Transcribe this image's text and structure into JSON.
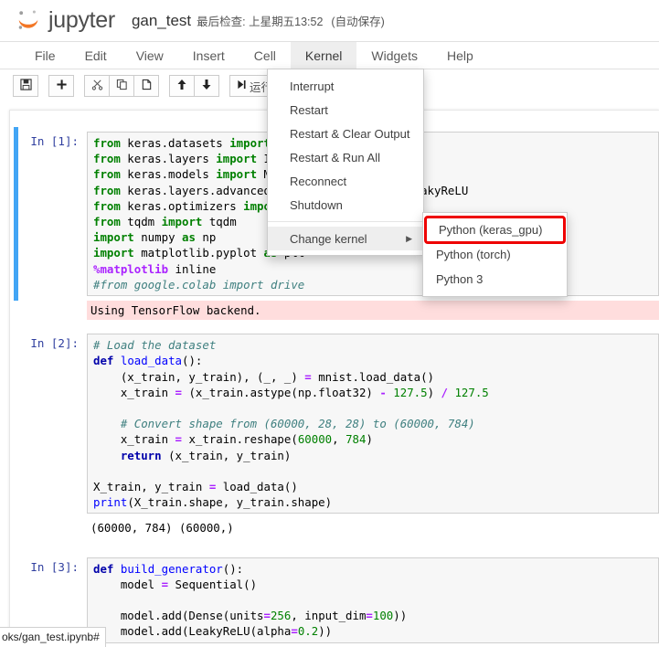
{
  "header": {
    "logo_icon": "jupyter-logo-icon",
    "brand": "jupyter",
    "notebook_name": "gan_test",
    "checkpoint": "最后检查: 上星期五13:52",
    "autosave": "(自动保存)",
    "accent_color": "#F37726"
  },
  "menubar": {
    "items": [
      {
        "label": "File",
        "active": false
      },
      {
        "label": "Edit",
        "active": false
      },
      {
        "label": "View",
        "active": false
      },
      {
        "label": "Insert",
        "active": false
      },
      {
        "label": "Cell",
        "active": false
      },
      {
        "label": "Kernel",
        "active": true
      },
      {
        "label": "Widgets",
        "active": false
      },
      {
        "label": "Help",
        "active": false
      }
    ]
  },
  "toolbar": {
    "save_icon": "floppy-disk-icon",
    "add_icon": "plus-icon",
    "cut_icon": "scissors-icon",
    "copy_icon": "copy-icon",
    "paste_icon": "paste-icon",
    "move_up_icon": "arrow-up-icon",
    "move_down_icon": "arrow-down-icon",
    "run_icon": "run-icon",
    "run_label": "运行",
    "cell_type_caret": "▼",
    "keyboard_icon": "keyboard-icon"
  },
  "kernel_menu": {
    "items": [
      {
        "label": "Interrupt",
        "hover": false,
        "submenu": false
      },
      {
        "label": "Restart",
        "hover": false,
        "submenu": false
      },
      {
        "label": "Restart & Clear Output",
        "hover": false,
        "submenu": false
      },
      {
        "label": "Restart & Run All",
        "hover": false,
        "submenu": false
      },
      {
        "label": "Reconnect",
        "hover": false,
        "submenu": false
      },
      {
        "label": "Shutdown",
        "hover": false,
        "submenu": false
      }
    ],
    "change_kernel": {
      "label": "Change kernel",
      "caret": "▶",
      "hover": true
    },
    "submenu": {
      "items": [
        {
          "label": "Python (keras_gpu)",
          "highlighted": true
        },
        {
          "label": "Python (torch)",
          "highlighted": false
        },
        {
          "label": "Python 3",
          "highlighted": false
        }
      ],
      "highlight_color": "#ee0000"
    }
  },
  "notebook": {
    "cells": [
      {
        "prompt": "In  [1]:",
        "selected": true,
        "code_lines": [
          [
            [
              "k",
              "from "
            ],
            [
              "p",
              "keras.datasets "
            ],
            [
              "k",
              "imp"
            ]
          ],
          [
            [
              "k",
              "from "
            ],
            [
              "p",
              "keras.layers "
            ],
            [
              "k",
              "impor"
            ]
          ],
          [
            [
              "k",
              "from "
            ],
            [
              "p",
              "keras.models "
            ],
            [
              "k",
              "impor"
            ]
          ],
          [
            [
              "k",
              "from "
            ],
            [
              "p",
              "keras.layers.advanc"
            ]
          ],
          [
            [
              "k",
              "from "
            ],
            [
              "p",
              "keras.optimizers "
            ],
            [
              "k",
              "i"
            ]
          ],
          [
            [
              "k",
              "from "
            ],
            [
              "p",
              "tqdm "
            ],
            [
              "k",
              "import "
            ],
            [
              "p",
              "tqdm"
            ]
          ],
          [
            [
              "k",
              "import "
            ],
            [
              "p",
              "numpy "
            ],
            [
              "k",
              "as "
            ],
            [
              "p",
              "np"
            ]
          ],
          [
            [
              "k",
              "import "
            ],
            [
              "p",
              "matplotlib.pyplot "
            ],
            [
              "k",
              "as "
            ],
            [
              "p",
              "plt"
            ]
          ],
          [
            [
              "m",
              "%matplotlib"
            ],
            [
              "p",
              " inline"
            ]
          ],
          [
            [
              "c",
              "#from google.colab import drive"
            ]
          ]
        ],
        "overflow_text": "eakyReLU",
        "output": {
          "text": "Using TensorFlow backend.",
          "stderr": true
        }
      },
      {
        "prompt": "In  [2]:",
        "selected": false,
        "code_lines": [
          [
            [
              "c",
              "# Load the dataset"
            ]
          ],
          [
            [
              "kn",
              "def "
            ],
            [
              "nf",
              "load_data"
            ],
            [
              "p",
              "():"
            ]
          ],
          [
            [
              "p",
              "    (x_train, y_train), (_, _) "
            ],
            [
              "o",
              "= "
            ],
            [
              "p",
              "mnist.load_data()"
            ]
          ],
          [
            [
              "p",
              "    x_train "
            ],
            [
              "o",
              "= "
            ],
            [
              "p",
              "(x_train.astype(np.float32) "
            ],
            [
              "o",
              "- "
            ],
            [
              "n",
              "127.5"
            ],
            [
              "p",
              ") "
            ],
            [
              "o",
              "/ "
            ],
            [
              "n",
              "127.5"
            ]
          ],
          [
            [
              "p",
              ""
            ]
          ],
          [
            [
              "c",
              "    # Convert shape from (60000, 28, 28) to (60000, 784)"
            ]
          ],
          [
            [
              "p",
              "    x_train "
            ],
            [
              "o",
              "= "
            ],
            [
              "p",
              "x_train.reshape("
            ],
            [
              "n",
              "60000"
            ],
            [
              "p",
              ", "
            ],
            [
              "n",
              "784"
            ],
            [
              "p",
              ")"
            ]
          ],
          [
            [
              "kn",
              "    return "
            ],
            [
              "p",
              "(x_train, y_train)"
            ]
          ],
          [
            [
              "p",
              ""
            ]
          ],
          [
            [
              "p",
              "X_train, y_train "
            ],
            [
              "o",
              "= "
            ],
            [
              "p",
              "load_data()"
            ]
          ],
          [
            [
              "nf",
              "print"
            ],
            [
              "p",
              "(X_train.shape, y_train.shape)"
            ]
          ]
        ],
        "output": {
          "text": "(60000, 784) (60000,)",
          "stderr": false
        }
      },
      {
        "prompt": "In  [3]:",
        "selected": false,
        "code_lines": [
          [
            [
              "kn",
              "def "
            ],
            [
              "nf",
              "build_generator"
            ],
            [
              "p",
              "():"
            ]
          ],
          [
            [
              "p",
              "    model "
            ],
            [
              "o",
              "= "
            ],
            [
              "p",
              "Sequential()"
            ]
          ],
          [
            [
              "p",
              ""
            ]
          ],
          [
            [
              "p",
              "    model.add(Dense(units"
            ],
            [
              "o",
              "="
            ],
            [
              "n",
              "256"
            ],
            [
              "p",
              ", input_dim"
            ],
            [
              "o",
              "="
            ],
            [
              "n",
              "100"
            ],
            [
              "p",
              "))"
            ]
          ],
          [
            [
              "p",
              "    model.add(LeakyReLU(alpha"
            ],
            [
              "o",
              "="
            ],
            [
              "n",
              "0.2"
            ],
            [
              "p",
              "))"
            ]
          ]
        ],
        "output": null
      }
    ]
  },
  "status_bar": {
    "link_text": "oks/gan_test.ipynb#"
  }
}
